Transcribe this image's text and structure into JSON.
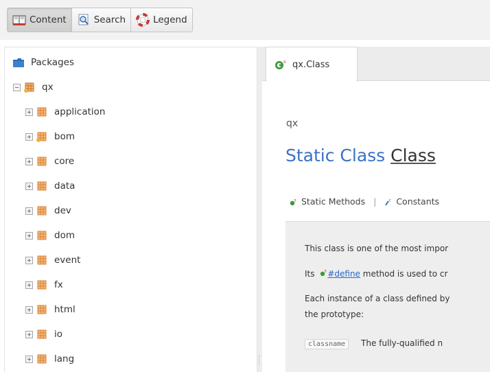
{
  "toolbar": {
    "buttons": [
      {
        "label": "Content",
        "icon": "book-icon",
        "active": true
      },
      {
        "label": "Search",
        "icon": "magnifier-icon",
        "active": false
      },
      {
        "label": "Legend",
        "icon": "lifebuoy-icon",
        "active": false
      }
    ]
  },
  "tree": {
    "root_label": "Packages",
    "package_label": "qx",
    "children": [
      "application",
      "bom",
      "core",
      "data",
      "dev",
      "dom",
      "event",
      "fx",
      "html",
      "io",
      "lang"
    ]
  },
  "tab": {
    "label": "qx.Class",
    "badge": "s"
  },
  "content": {
    "package_name": "qx",
    "title_prefix": "Static Class",
    "title_name": "Class",
    "links": {
      "static_methods": "Static Methods",
      "separator": "|",
      "constants": "Constants"
    },
    "description": {
      "line1": "This class is one of the most impor",
      "line2_prefix": "Its",
      "line2_link": "#define",
      "line2_suffix": "method is used to cr",
      "line3": "Each instance of a class defined by",
      "line4": "the prototype:",
      "row1_code": "classname",
      "row1_text": "The fully-qualified n"
    }
  },
  "colors": {
    "accent_blue": "#3b72c4",
    "link_blue": "#2a66c8",
    "package_orange": "#d9823b",
    "static_green": "#3a9b3a",
    "badge_red": "#d23a3a"
  }
}
